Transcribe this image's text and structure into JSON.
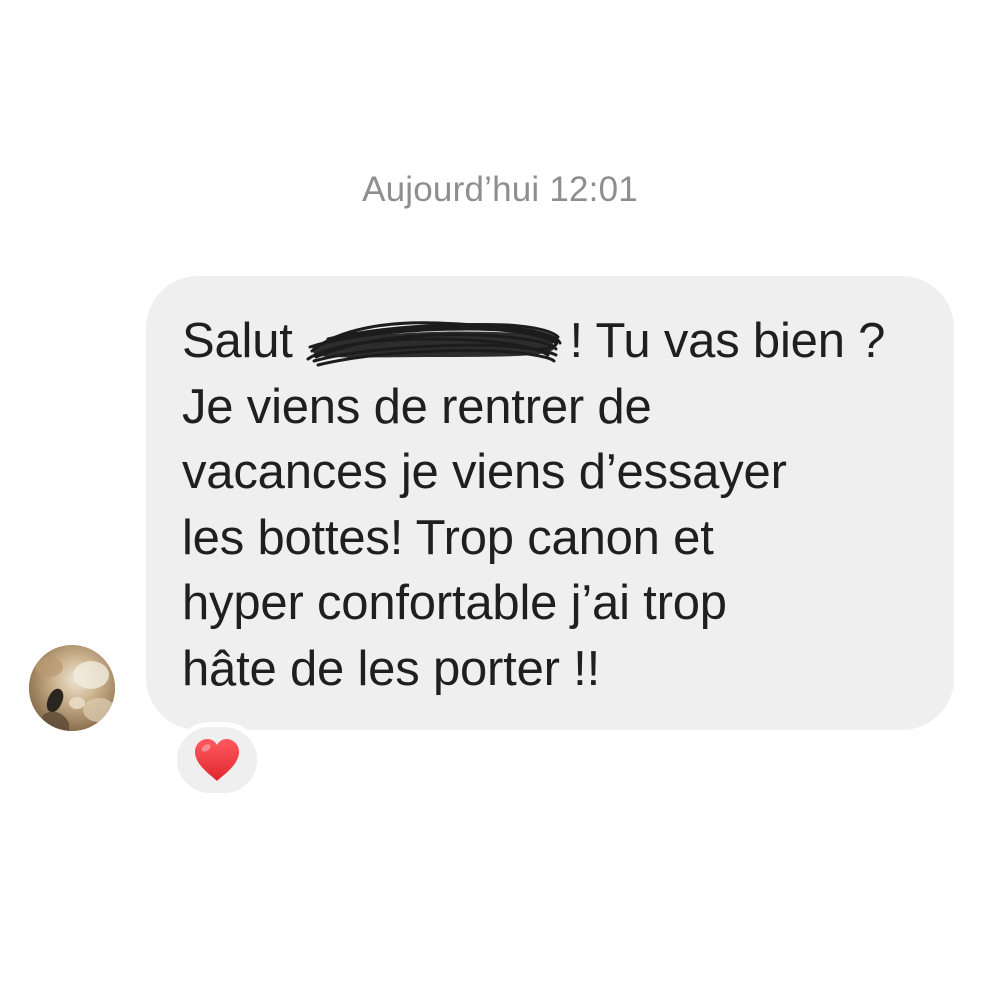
{
  "timestamp": "Aujourd’hui 12:01",
  "message": {
    "line1_before": "Salut ",
    "line1_after": " ! Tu vas bien ?",
    "line2": "Je viens de rentrer de",
    "line3": "vacances je viens d’essayer",
    "line4": "les bottes! Trop canon et",
    "line5": "hyper confortable j’ai trop",
    "line6": "hâte de les porter !!"
  },
  "reaction": {
    "icon": "heart-icon",
    "color": "#e8323a"
  },
  "colors": {
    "bubble": "#efefef",
    "timestamp": "#8e8e8e",
    "text": "#1f1f1f"
  }
}
